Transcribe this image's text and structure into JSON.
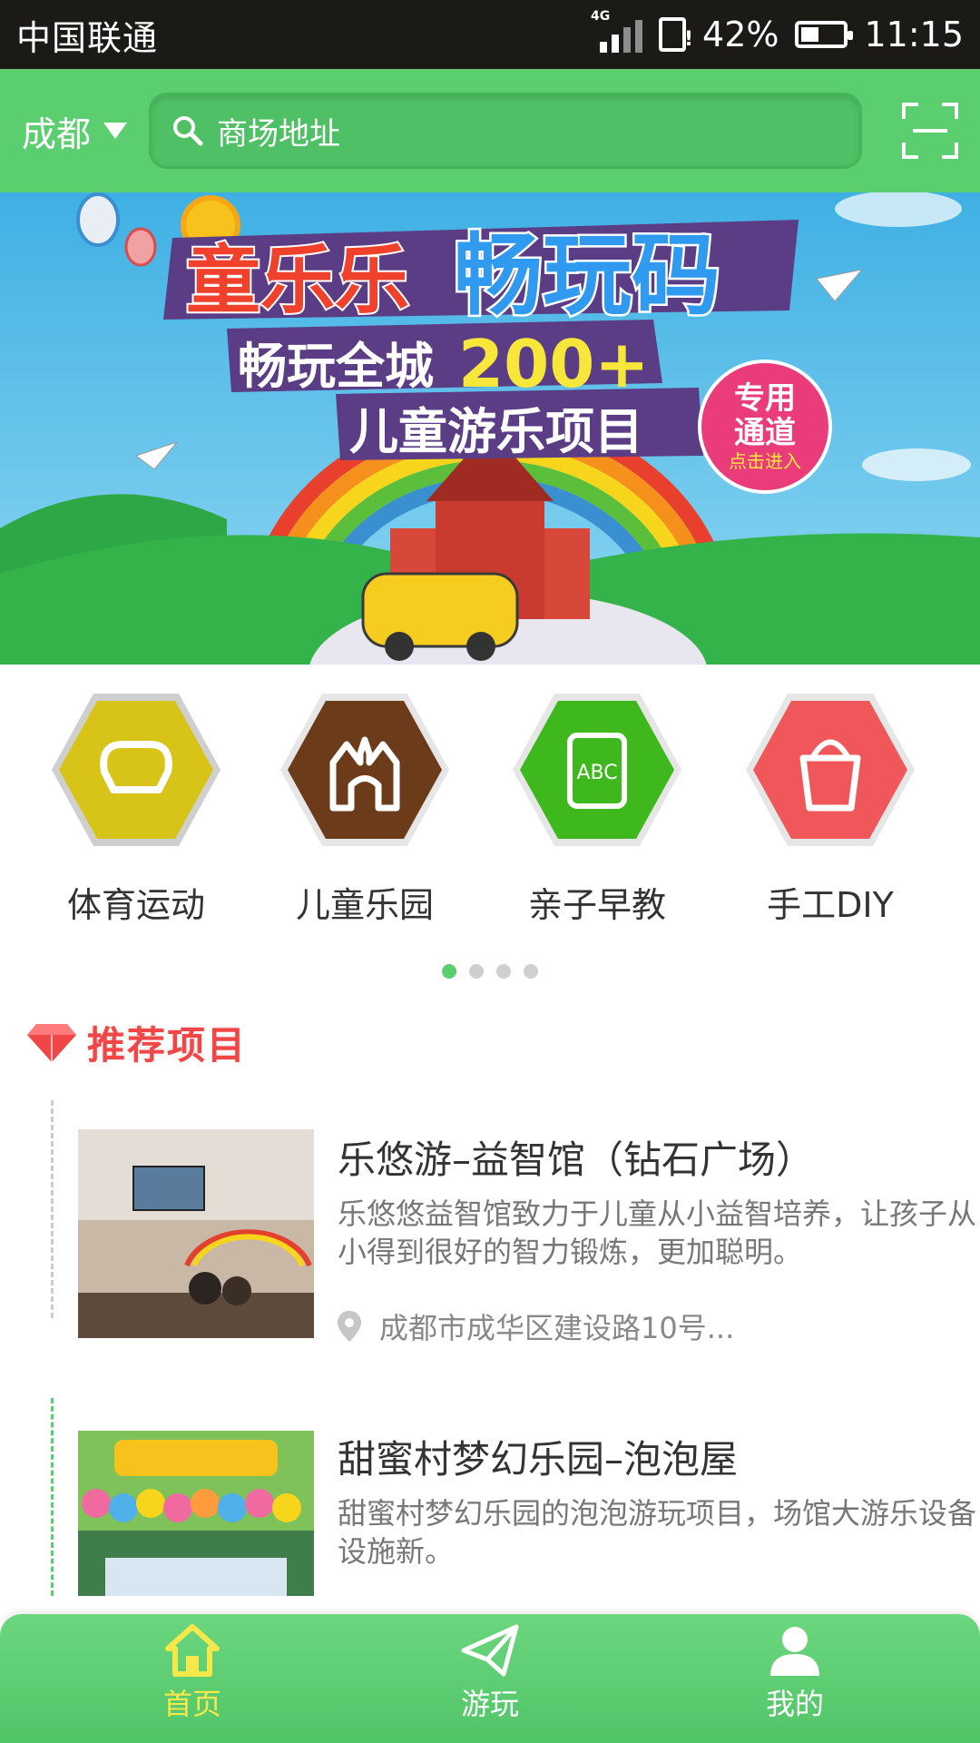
{
  "status_bar": {
    "carrier": "中国联通",
    "network": "4G",
    "battery": "42%",
    "battery_level": 0.42,
    "time": "11:15"
  },
  "header": {
    "city": "成都",
    "search_placeholder": "商场地址"
  },
  "banner": {
    "line1_a": "童乐乐",
    "line1_b": "畅玩码",
    "line2_a": "畅玩全城",
    "line2_b": "200+",
    "line3": "儿童游乐项目",
    "badge_1": "专用",
    "badge_2": "通道",
    "badge_3": "点击进入"
  },
  "categories": [
    {
      "label": "体育运动",
      "icon": "muscle-icon",
      "color": "#d8c419"
    },
    {
      "label": "儿童乐园",
      "icon": "castle-icon",
      "color": "#6b3b1a"
    },
    {
      "label": "亲子早教",
      "icon": "abc-book-icon",
      "color": "#3fb81e"
    },
    {
      "label": "手工DIY",
      "icon": "paint-bucket-icon",
      "color": "#f0575a"
    }
  ],
  "pager": {
    "pages": 4,
    "active": 1
  },
  "section": {
    "title": "推荐项目",
    "icon": "diamond-icon"
  },
  "items": [
    {
      "title": "乐悠游–益智馆（钻石广场）",
      "desc": "乐悠悠益智馆致力于儿童从小益智培养，让孩子从小得到很好的智力锻炼，更加聪明。",
      "address": "成都市成华区建设路10号..."
    },
    {
      "title": "甜蜜村梦幻乐园–泡泡屋",
      "desc": "甜蜜村梦幻乐园的泡泡游玩项目，场馆大游乐设备设施新。"
    }
  ],
  "tabs": [
    {
      "label": "首页",
      "icon": "home-icon",
      "active": true
    },
    {
      "label": "游玩",
      "icon": "paper-plane-icon",
      "active": false
    },
    {
      "label": "我的",
      "icon": "user-icon",
      "active": false
    }
  ],
  "colors": {
    "primary": "#5bcf70",
    "accent_red": "#f04648",
    "active_tab": "#f7e84a"
  }
}
